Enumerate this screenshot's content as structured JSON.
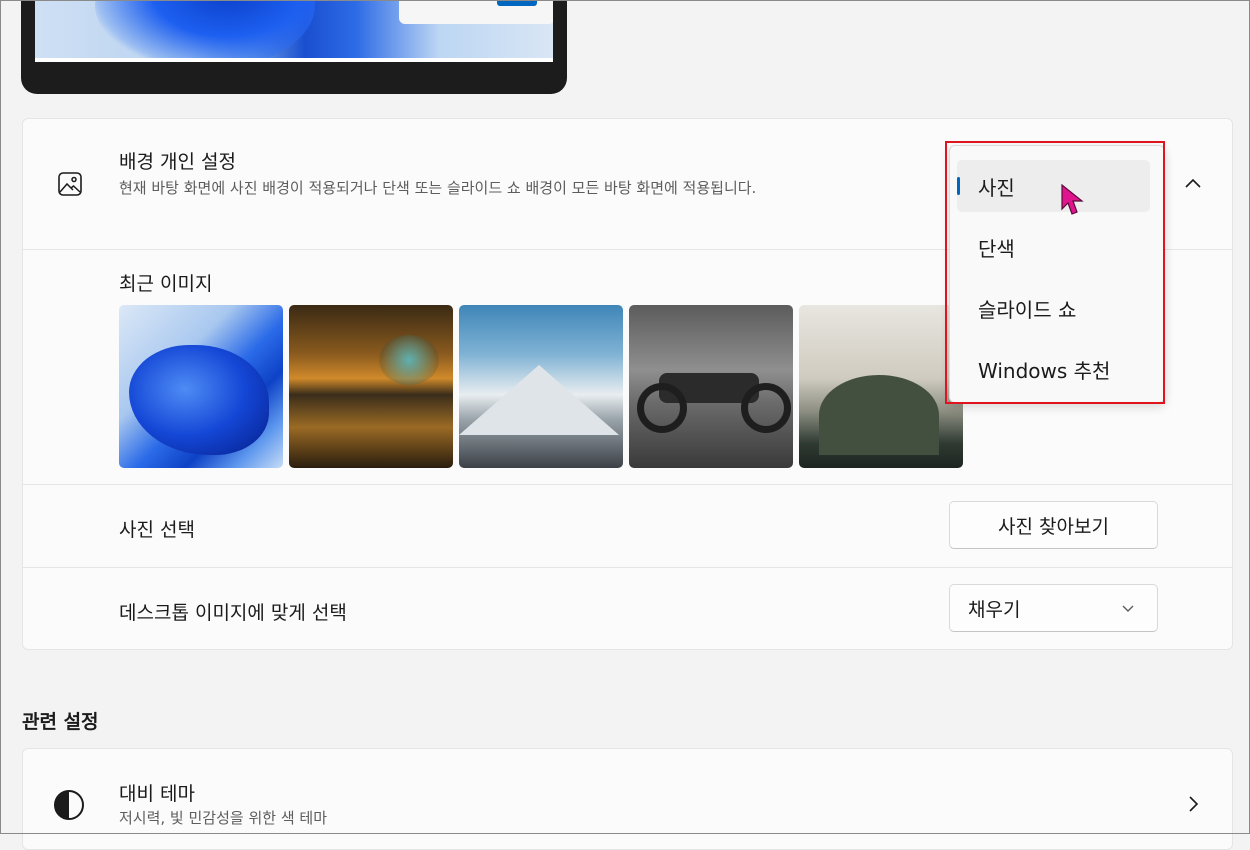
{
  "background": {
    "title": "배경 개인 설정",
    "description": "현재 바탕 화면에 사진 배경이 적용되거나 단색 또는 슬라이드 쇼 배경이 모든 바탕 화면에 적용됩니다.",
    "icon": "image-icon",
    "dropdown_options": [
      "사진",
      "단색",
      "슬라이드 쇼",
      "Windows 추천"
    ],
    "selected": "사진"
  },
  "recent": {
    "label": "최근 이미지",
    "images": [
      "bloom-blue",
      "cave-lake",
      "snowy-mountains",
      "motorcycle-bw",
      "misty-hill"
    ]
  },
  "choose_photo": {
    "label": "사진 선택",
    "button": "사진 찾아보기"
  },
  "fit": {
    "label": "데스크톱 이미지에 맞게 선택",
    "value": "채우기"
  },
  "related": {
    "title": "관련 설정",
    "contrast_title": "대비 테마",
    "contrast_desc": "저시력, 빛 민감성을 위한 색 테마"
  },
  "colors": {
    "accent": "#0067c0",
    "highlight_border": "#e0141e",
    "cursor": "#e0148c"
  }
}
